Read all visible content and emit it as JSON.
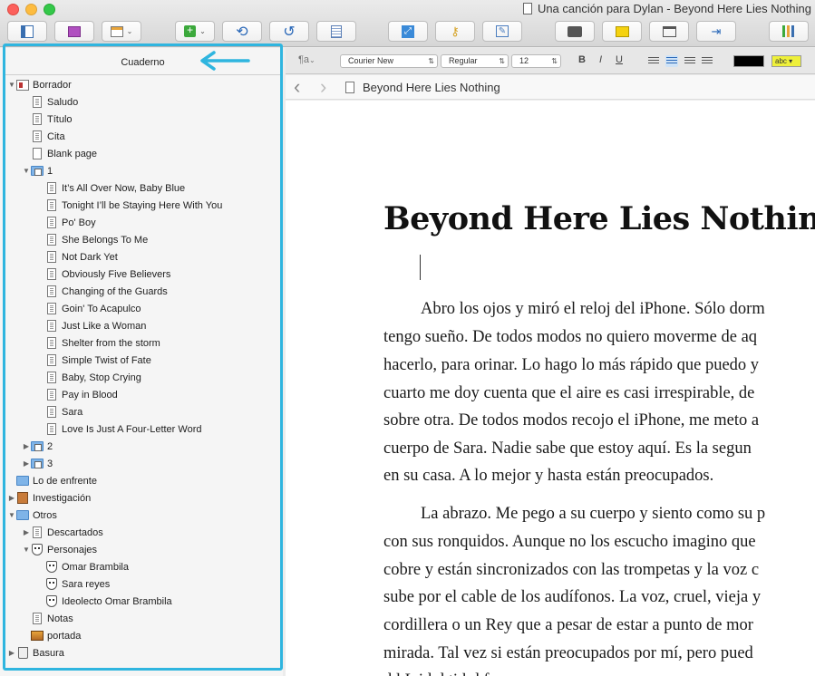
{
  "window": {
    "title": "Una canción para Dylan - Beyond Here Lies Nothing"
  },
  "colors": {
    "highlight_border": "#2fb5df",
    "close": "#fc605c",
    "minimize": "#fdbc40",
    "zoom": "#34c84a"
  },
  "binder": {
    "header": "Cuaderno",
    "items": [
      {
        "label": "Borrador",
        "level": 0,
        "tri": "▼",
        "icon": "book"
      },
      {
        "label": "Saludo",
        "level": 1,
        "tri": "",
        "icon": "doc"
      },
      {
        "label": "Título",
        "level": 1,
        "tri": "",
        "icon": "doc"
      },
      {
        "label": "Cita",
        "level": 1,
        "tri": "",
        "icon": "doc"
      },
      {
        "label": "Blank page",
        "level": 1,
        "tri": "",
        "icon": "doc-blank"
      },
      {
        "label": "1",
        "level": 1,
        "tri": "▼",
        "icon": "folder"
      },
      {
        "label": "It’s All Over Now, Baby Blue",
        "level": 2,
        "tri": "",
        "icon": "doc"
      },
      {
        "label": "Tonight I’ll be Staying Here With You",
        "level": 2,
        "tri": "",
        "icon": "doc"
      },
      {
        "label": "Po' Boy",
        "level": 2,
        "tri": "",
        "icon": "doc"
      },
      {
        "label": "She Belongs To Me",
        "level": 2,
        "tri": "",
        "icon": "doc"
      },
      {
        "label": "Not Dark Yet",
        "level": 2,
        "tri": "",
        "icon": "doc"
      },
      {
        "label": "Obviously Five Believers",
        "level": 2,
        "tri": "",
        "icon": "doc"
      },
      {
        "label": "Changing of the Guards",
        "level": 2,
        "tri": "",
        "icon": "doc"
      },
      {
        "label": "Goin' To Acapulco",
        "level": 2,
        "tri": "",
        "icon": "doc"
      },
      {
        "label": "Just Like a Woman",
        "level": 2,
        "tri": "",
        "icon": "doc"
      },
      {
        "label": "Shelter from the storm",
        "level": 2,
        "tri": "",
        "icon": "doc"
      },
      {
        "label": "Simple Twist of Fate",
        "level": 2,
        "tri": "",
        "icon": "doc"
      },
      {
        "label": "Baby, Stop Crying",
        "level": 2,
        "tri": "",
        "icon": "doc"
      },
      {
        "label": "Pay in Blood",
        "level": 2,
        "tri": "",
        "icon": "doc"
      },
      {
        "label": "Sara",
        "level": 2,
        "tri": "",
        "icon": "doc"
      },
      {
        "label": "Love Is Just A Four-Letter Word",
        "level": 2,
        "tri": "",
        "icon": "doc"
      },
      {
        "label": "2",
        "level": 1,
        "tri": "▶",
        "icon": "folder"
      },
      {
        "label": "3",
        "level": 1,
        "tri": "▶",
        "icon": "folder"
      },
      {
        "label": "Lo de enfrente",
        "level": 0,
        "tri": "",
        "icon": "folder-plain"
      },
      {
        "label": "Investigación",
        "level": 0,
        "tri": "▶",
        "icon": "corkboard"
      },
      {
        "label": "Otros",
        "level": 0,
        "tri": "▼",
        "icon": "folder-plain"
      },
      {
        "label": "Descartados",
        "level": 1,
        "tri": "▶",
        "icon": "doc"
      },
      {
        "label": "Personajes",
        "level": 1,
        "tri": "▼",
        "icon": "mask"
      },
      {
        "label": "Omar Brambila",
        "level": 2,
        "tri": "",
        "icon": "mask"
      },
      {
        "label": "Sara reyes",
        "level": 2,
        "tri": "",
        "icon": "mask"
      },
      {
        "label": "Ideolecto Omar Brambila",
        "level": 2,
        "tri": "",
        "icon": "mask"
      },
      {
        "label": "Notas",
        "level": 1,
        "tri": "",
        "icon": "doc"
      },
      {
        "label": "portada",
        "level": 1,
        "tri": "",
        "icon": "pic"
      },
      {
        "label": "Basura",
        "level": 0,
        "tri": "▶",
        "icon": "trash"
      }
    ]
  },
  "format": {
    "para_style": "¶a",
    "font": "Courier New",
    "weight": "Regular",
    "size": "12",
    "bold": "B",
    "italic": "I",
    "underline": "U",
    "highlight_label": "abc"
  },
  "header": {
    "back": "‹",
    "forward": "›",
    "doc_title": "Beyond Here Lies Nothing"
  },
  "editor": {
    "heading": "Beyond Here Lies Nothing",
    "lines": [
      "Abro los ojos y miró el reloj del iPhone. Sólo dorm",
      "tengo sueño. De todos modos no quiero moverme de aq",
      "hacerlo, para orinar. Lo hago lo más rápido que puedo y",
      "cuarto me doy cuenta que el aire es casi irrespirable, de",
      "sobre otra. De todos modos recojo el iPhone, me meto a",
      "cuerpo de Sara. Nadie sabe que estoy aquí. Es la segun",
      "en su casa. A lo mejor y hasta están preocupados.",
      "La abrazo. Me pego a su cuerpo y siento como su p",
      "con  sus ronquidos. Aunque no los escucho imagino que",
      "cobre y están sincronizados con las trompetas y la voz c",
      "sube por el cable de los audífonos. La voz, cruel, vieja y",
      "cordillera o un Rey que a pesar de estar a punto de mor",
      "mirada. Tal vez si están preocupados por mí, pero pued",
      "d l        L  id d                 ti l      d  f"
    ]
  }
}
